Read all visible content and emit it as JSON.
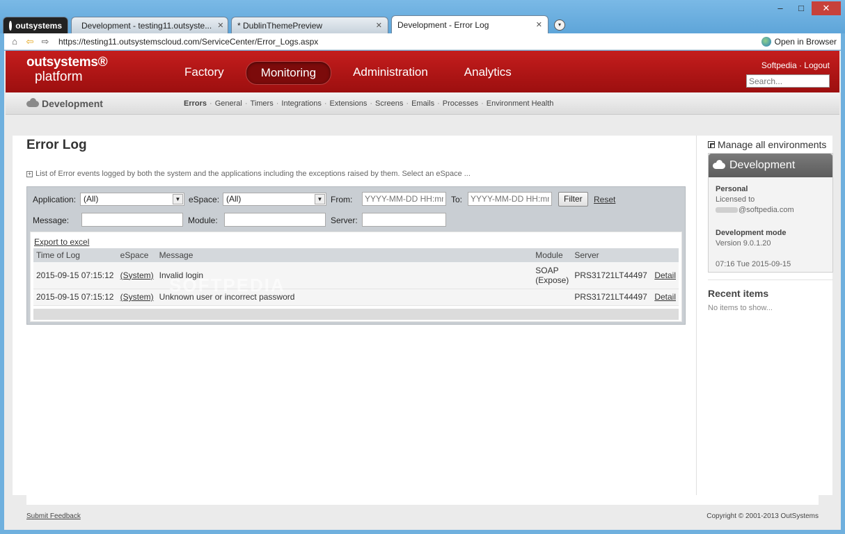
{
  "window": {
    "minimize": "–",
    "maximize": "□",
    "close": "✕"
  },
  "tabs": [
    {
      "label": "outsystems"
    },
    {
      "label": "Development - testing11.outsyste...",
      "close": "✕"
    },
    {
      "label": "* DublinThemePreview",
      "close": "✕"
    },
    {
      "label": "Development - Error Log",
      "close": "✕"
    }
  ],
  "tab_menu": "▾",
  "address": {
    "url": "https://testing11.outsystemscloud.com/ServiceCenter/Error_Logs.aspx",
    "open_in_browser": "Open in Browser"
  },
  "header": {
    "logo_line1": "outsystems®",
    "logo_line2": "platform",
    "nav": [
      "Factory",
      "Monitoring",
      "Administration",
      "Analytics"
    ],
    "user": "Softpedia",
    "logout": "Logout",
    "link_sep": " · ",
    "search_placeholder": "Search..."
  },
  "subnav": {
    "environment": "Development",
    "tabs": [
      "Errors",
      "General",
      "Timers",
      "Integrations",
      "Extensions",
      "Screens",
      "Emails",
      "Processes",
      "Environment Health"
    ]
  },
  "page": {
    "title": "Error Log",
    "description": "List of Error events logged by both the system and the applications including the exceptions raised by them. Select an eSpace ..."
  },
  "filters": {
    "application_label": "Application:",
    "application_value": "(All)",
    "espace_label": "eSpace:",
    "espace_value": "(All)",
    "from_label": "From:",
    "from_placeholder": "YYYY-MM-DD HH:mm",
    "to_label": "To:",
    "to_placeholder": "YYYY-MM-DD HH:mm",
    "filter_button": "Filter",
    "reset_link": "Reset",
    "message_label": "Message:",
    "module_label": "Module:",
    "server_label": "Server:"
  },
  "results": {
    "export": "Export to excel",
    "columns": [
      "Time of Log",
      "eSpace",
      "Message",
      "Module",
      "Server",
      ""
    ],
    "rows": [
      {
        "time": "2015-09-15 07:15:12",
        "espace": "(System)",
        "message": "Invalid login",
        "module_1": "SOAP",
        "module_2": "(Expose)",
        "server": "PRS31721LT44497",
        "action": "Detail"
      },
      {
        "time": "2015-09-15 07:15:12",
        "espace": "(System)",
        "message": "Unknown user or incorrect password",
        "module_1": "",
        "module_2": "",
        "server": "PRS31721LT44497",
        "action": "Detail"
      }
    ]
  },
  "side": {
    "manage": "Manage all environments",
    "env_title": "Development",
    "plan": "Personal",
    "licensed_to": "Licensed to",
    "email": "@softpedia.com",
    "mode": "Development mode",
    "version": "Version 9.0.1.20",
    "time": "07:16 Tue 2015-09-15",
    "recent_title": "Recent items",
    "recent_empty": "No items to show..."
  },
  "footer": {
    "feedback": "Submit Feedback",
    "copyright": "Copyright ©  2001-2013 OutSystems"
  },
  "watermark": "SOFTPEDIA"
}
